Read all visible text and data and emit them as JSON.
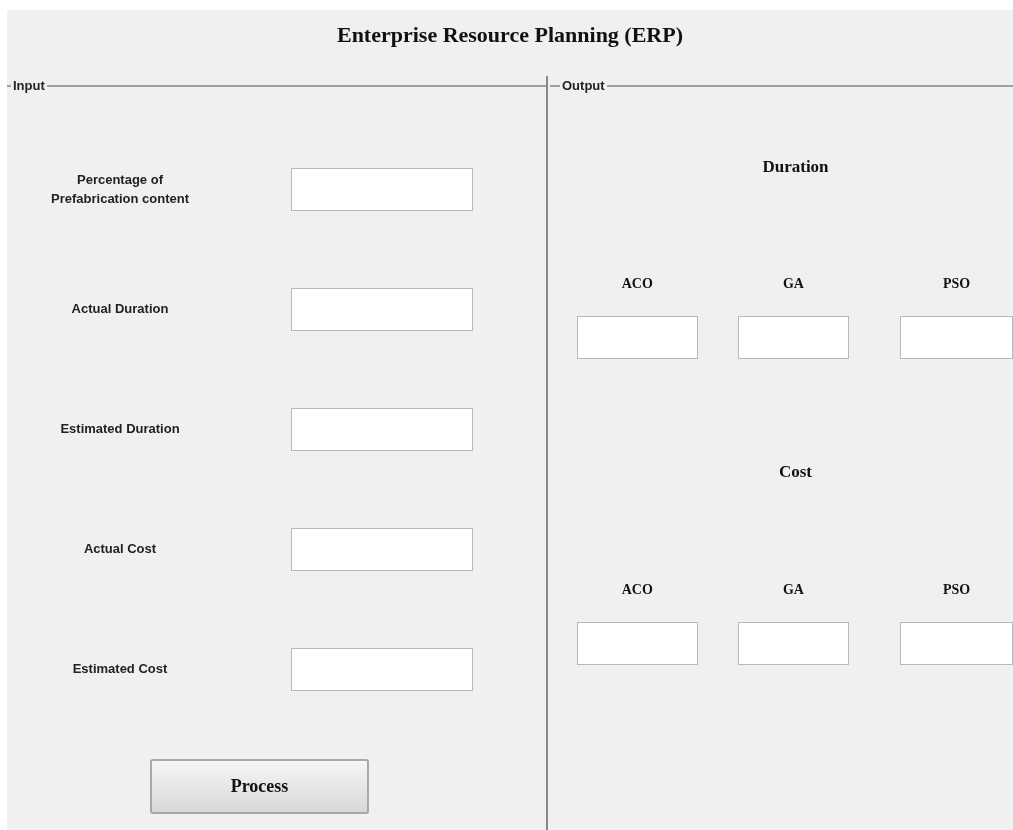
{
  "title": "Enterprise Resource Planning (ERP)",
  "input": {
    "legend": "Input",
    "fields": [
      {
        "label": "Percentage of Prefabrication content"
      },
      {
        "label": "Actual Duration"
      },
      {
        "label": "Estimated Duration"
      },
      {
        "label": "Actual Cost"
      },
      {
        "label": "Estimated Cost"
      }
    ],
    "button": "Process"
  },
  "output": {
    "legend": "Output",
    "sections": [
      {
        "heading": "Duration",
        "methods": [
          "ACO",
          "GA",
          "PSO"
        ]
      },
      {
        "heading": "Cost",
        "methods": [
          "ACO",
          "GA",
          "PSO"
        ]
      }
    ]
  }
}
